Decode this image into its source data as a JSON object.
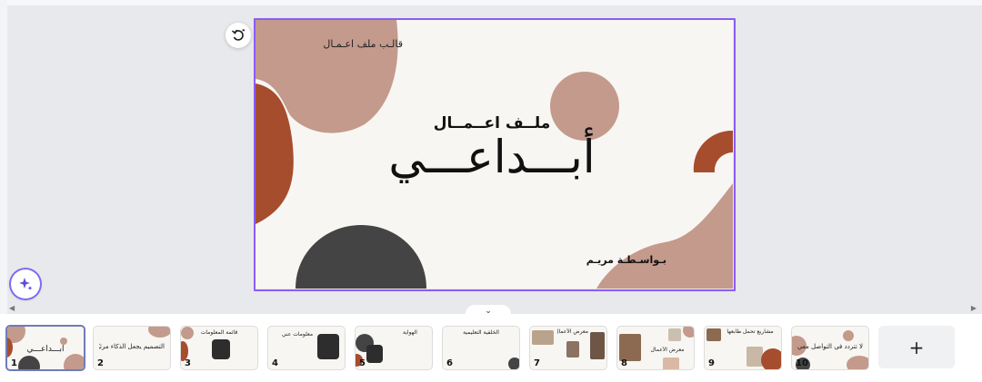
{
  "slide": {
    "template_label": "قالـب ملف اعـمـال",
    "subtitle": "ملــف اعــمــال",
    "title": "أبـــداعـــي",
    "author": "بـواسـطـة مريـم"
  },
  "controls": {
    "rotate_icon": "rotate-icon",
    "magic_icon": "sparkle-icon",
    "collapse_icon": "chevron-down-icon",
    "add_page_label": "+"
  },
  "thumbnails": [
    {
      "number": "1",
      "title": "أبـــداعـــي"
    },
    {
      "number": "2",
      "title": "التصميم يجعل الذكاء مرئيًا"
    },
    {
      "number": "3",
      "title": "قائمة المعلومات"
    },
    {
      "number": "4",
      "title": "معلومات عني"
    },
    {
      "number": "5",
      "title": "الهواية"
    },
    {
      "number": "6",
      "title": "الخلفية التعليمية"
    },
    {
      "number": "7",
      "title": "معرض الأعمال"
    },
    {
      "number": "8",
      "title": "معرض الأعمال"
    },
    {
      "number": "9",
      "title": "مشاريع تحمل طابعها"
    },
    {
      "number": "10",
      "title": "لا تتردد في التواصل معي"
    }
  ],
  "colors": {
    "accent": "#8b5cf6",
    "rust": "#a64d2d",
    "rose": "#c49a8c",
    "charcoal": "#444444",
    "paper": "#f8f6f2"
  }
}
